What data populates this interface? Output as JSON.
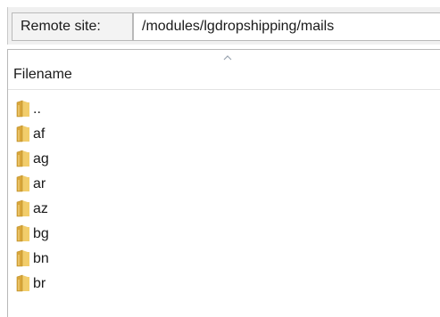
{
  "remote_site": {
    "label": "Remote site:",
    "path": "/modules/lgdropshipping/mails"
  },
  "file_list": {
    "column_header": "Filename",
    "sort_icon": "sort-ascending-icon",
    "folder_icon": "folder-icon",
    "folder_color": "#e8b84a",
    "entries": [
      {
        "name": ".."
      },
      {
        "name": "af"
      },
      {
        "name": "ag"
      },
      {
        "name": "ar"
      },
      {
        "name": "az"
      },
      {
        "name": "bg"
      },
      {
        "name": "bn"
      },
      {
        "name": "br"
      }
    ]
  }
}
